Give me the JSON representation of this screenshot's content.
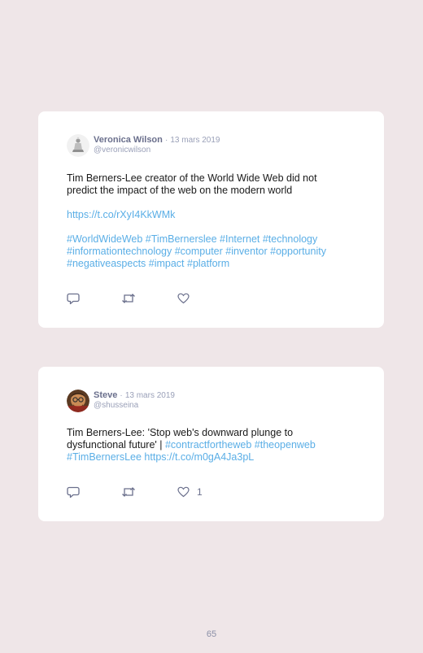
{
  "tweets": [
    {
      "name": "Veronica Wilson",
      "separator": "·",
      "date": "13 mars 2019",
      "handle": "@veronicwilson",
      "text_line1": "Tim Berners-Lee creator of the World Wide Web did not",
      "text_line2": "predict the impact of the web on the modern world",
      "url": "https://t.co/rXyI4KkWMk",
      "hashtags_line1": "#WorldWideWeb #TimBernerslee #Internet #technology",
      "hashtags_line2": "#informationtechnology #computer #inventor #opportunity",
      "hashtags_line3": "#negativeaspects #impact #platform",
      "actions": {
        "reply_icon": "reply-icon",
        "retweet_icon": "retweet-icon",
        "like_icon": "heart-icon"
      }
    },
    {
      "name": "Steve",
      "separator": "·",
      "date": "13 mars 2019",
      "handle": "@shusseina",
      "text_line1": "Tim Berners-Lee: 'Stop web's downward plunge to",
      "text_line2_plain": "dysfunctional future' | ",
      "text_line2_tags": "#contractfortheweb #theopenweb",
      "text_line3_tag": "#TimBernersLee",
      "text_line3_url": "https://t.co/m0gA4Ja3pL",
      "like_count": "1",
      "actions": {
        "reply_icon": "reply-icon",
        "retweet_icon": "retweet-icon",
        "like_icon": "heart-icon"
      }
    }
  ],
  "page_number": "65",
  "colors": {
    "background": "#efe6e8",
    "card": "#ffffff",
    "link": "#5aaee6",
    "name": "#6a6f8c",
    "muted": "#9aa0b8"
  }
}
